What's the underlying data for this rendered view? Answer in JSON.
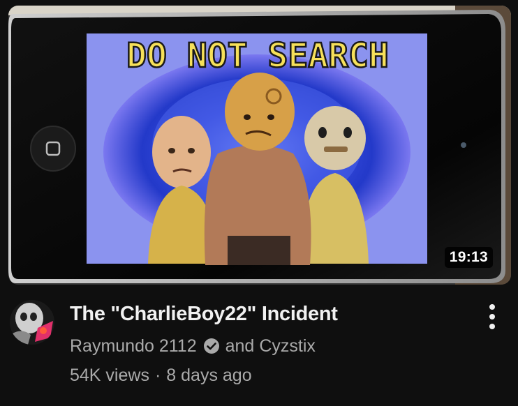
{
  "video": {
    "thumbnail_caption": "DO NOT SEARCH",
    "duration": "19:13",
    "title": "The \"CharlieBoy22\" Incident",
    "channel_primary": "Raymundo 2112",
    "channel_connector": "and",
    "channel_secondary": "Cyzstix",
    "views": "54K views",
    "separator": "·",
    "age": "8 days ago"
  },
  "icons": {
    "verified": "check-circle-icon",
    "menu": "more-vertical-icon"
  },
  "colors": {
    "background": "#0f0f0f",
    "title": "#f1f1f1",
    "secondary_text": "#aaaaaa",
    "duration_bg": "#000000"
  }
}
